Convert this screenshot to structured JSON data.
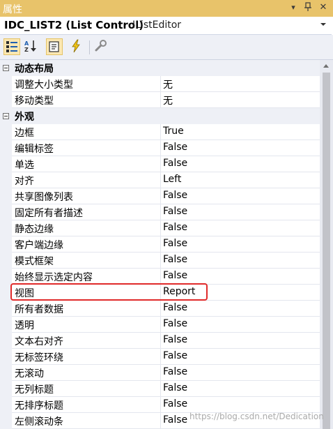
{
  "window": {
    "title": "属性"
  },
  "object_selector": {
    "name": "IDC_LIST2 (List Control)",
    "type": "IListEditor"
  },
  "toolbar": {
    "buttons": [
      "categorized-view",
      "alphabetical-sort",
      "properties",
      "control-events",
      "property-pages"
    ]
  },
  "categories": [
    {
      "label": "动态布局",
      "collapse_glyph": "minus"
    },
    {
      "label": "外观",
      "collapse_glyph": "minus"
    }
  ],
  "layout_props": [
    {
      "name": "调整大小类型",
      "value": "无"
    },
    {
      "name": "移动类型",
      "value": "无"
    }
  ],
  "appearance_props": [
    {
      "name": "边框",
      "value": "True"
    },
    {
      "name": "编辑标签",
      "value": "False"
    },
    {
      "name": "单选",
      "value": "False"
    },
    {
      "name": "对齐",
      "value": "Left"
    },
    {
      "name": "共享图像列表",
      "value": "False"
    },
    {
      "name": "固定所有者描述",
      "value": "False"
    },
    {
      "name": "静态边缘",
      "value": "False"
    },
    {
      "name": "客户端边缘",
      "value": "False"
    },
    {
      "name": "模式框架",
      "value": "False"
    },
    {
      "name": "始终显示选定内容",
      "value": "False"
    },
    {
      "name": "视图",
      "value": "Report"
    },
    {
      "name": "所有者数据",
      "value": "False"
    },
    {
      "name": "透明",
      "value": "False"
    },
    {
      "name": "文本右对齐",
      "value": "False"
    },
    {
      "name": "无标签环绕",
      "value": "False"
    },
    {
      "name": "无滚动",
      "value": "False"
    },
    {
      "name": "无列标题",
      "value": "False"
    },
    {
      "name": "无排序标题",
      "value": "False"
    },
    {
      "name": "左侧滚动条",
      "value": "False"
    }
  ],
  "highlight": {
    "property": "视图",
    "color": "#e02a2a"
  },
  "watermark": "https://blog.csdn.net/Dedication",
  "colors": {
    "title_bar": "#e8c36a",
    "toolbar_active": "#fbe7b2",
    "grid_gutter": "#eef0f6"
  }
}
